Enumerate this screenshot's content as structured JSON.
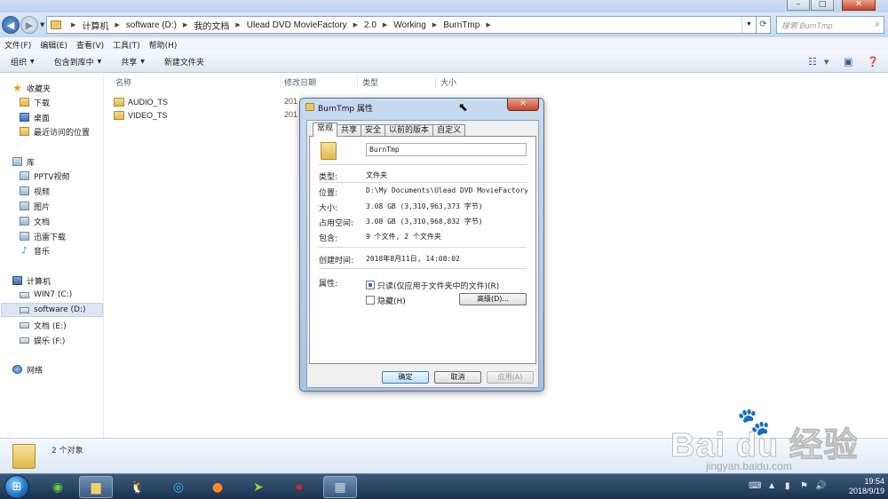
{
  "window": {
    "controls": [
      "–",
      "□",
      "✕"
    ]
  },
  "address": {
    "crumbs": [
      "计算机",
      "software (D:)",
      "我的文档",
      "Ulead DVD MovieFactory",
      "2.0",
      "Working",
      "BurnTmp"
    ],
    "search_placeholder": "搜索 BurnTmp"
  },
  "menu": [
    "文件(F)",
    "编辑(E)",
    "查看(V)",
    "工具(T)",
    "帮助(H)"
  ],
  "toolbar": {
    "organize": "组织",
    "include_library": "包含到库中",
    "share": "共享",
    "new_folder": "新建文件夹"
  },
  "sidebar": {
    "favorites": {
      "label": "收藏夹",
      "items": [
        "下载",
        "桌面",
        "最近访问的位置"
      ]
    },
    "libraries": {
      "label": "库",
      "items": [
        "PPTV视频",
        "视频",
        "图片",
        "文档",
        "迅雷下载",
        "音乐"
      ]
    },
    "computer": {
      "label": "计算机",
      "items": [
        "WIN7 (C:)",
        "software (D:)",
        "文档 (E:)",
        "娱乐 (F:)"
      ]
    },
    "network": {
      "label": "网络"
    }
  },
  "filelist": {
    "columns": [
      "名称",
      "修改日期",
      "类型",
      "大小"
    ],
    "rows": [
      {
        "name": "AUDIO_TS",
        "date": "201"
      },
      {
        "name": "VIDEO_TS",
        "date": "201"
      }
    ]
  },
  "details": {
    "count": "2 个对象"
  },
  "dialog": {
    "title": "BurnTmp 属性",
    "tabs": [
      "常规",
      "共享",
      "安全",
      "以前的版本",
      "自定义"
    ],
    "name": "BurnTmp",
    "props": {
      "type_label": "类型:",
      "type_value": "文件夹",
      "location_label": "位置:",
      "location_value": "D:\\My Documents\\Ulead DVD MovieFactory\\2.",
      "size_label": "大小:",
      "size_value": "3.08 GB (3,310,963,373 字节)",
      "disk_label": "占用空间:",
      "disk_value": "3.08 GB (3,310,968,832 字节)",
      "contains_label": "包含:",
      "contains_value": "9 个文件, 2 个文件夹",
      "created_label": "创建时间:",
      "created_value": "2018年8月11日, 14:08:02",
      "attr_label": "属性:",
      "readonly_label": "只读(仅应用于文件夹中的文件)(R)",
      "hidden_label": "隐藏(H)",
      "advanced_label": "高级(D)..."
    },
    "buttons": {
      "ok": "确定",
      "cancel": "取消",
      "apply": "应用(A)"
    }
  },
  "taskbar": {
    "time": "19:54",
    "date": "2018/9/19"
  },
  "watermark": {
    "main": "Bai du 经验",
    "sub": "jingyan.baidu.com"
  }
}
